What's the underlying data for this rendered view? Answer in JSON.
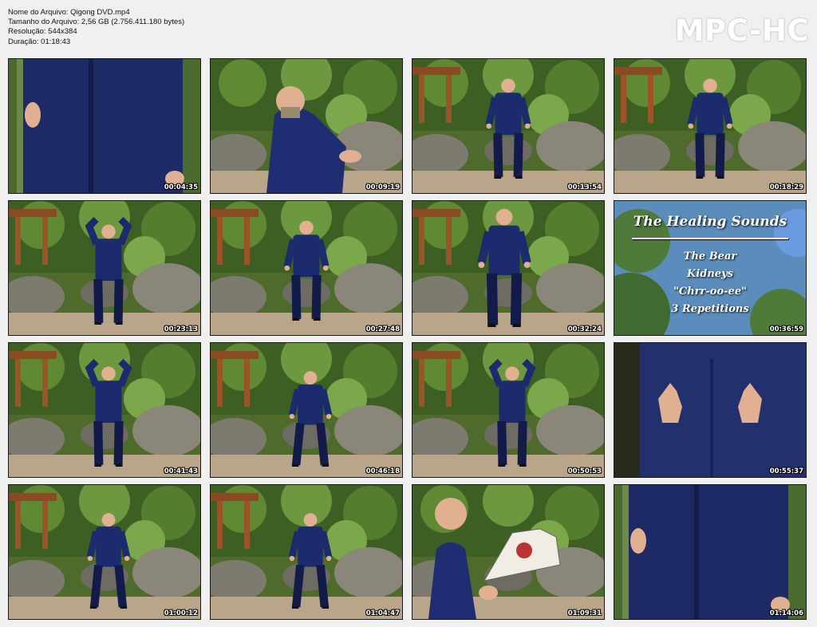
{
  "file_info": {
    "name": "Nome do Arquivo: Qigong DVD.mp4",
    "size": "Tamanho do Arquivo: 2,56 GB (2.756.411.180 bytes)",
    "resolution": "Resolução: 544x384",
    "duration": "Duração: 01:18:43"
  },
  "brand": "MPC-HC",
  "title_card": {
    "title": "The Healing Sounds",
    "lines": [
      "The Bear",
      "Kidneys",
      "\"Chrr-oo-ee\"",
      "3 Repetitions"
    ]
  },
  "thumbnails": [
    {
      "time": "00:04:35",
      "scene": "closeup-back"
    },
    {
      "time": "00:09:19",
      "scene": "closeup-side"
    },
    {
      "time": "00:13:54",
      "scene": "stand"
    },
    {
      "time": "00:18:29",
      "scene": "stand"
    },
    {
      "time": "00:23:13",
      "scene": "arms-up"
    },
    {
      "time": "00:27:48",
      "scene": "stand"
    },
    {
      "time": "00:32:24",
      "scene": "stand-close"
    },
    {
      "time": "00:36:59",
      "scene": "title"
    },
    {
      "time": "00:41:43",
      "scene": "arms-up"
    },
    {
      "time": "00:46:18",
      "scene": "wide-stance"
    },
    {
      "time": "00:50:53",
      "scene": "arms-up"
    },
    {
      "time": "00:55:37",
      "scene": "hands-back"
    },
    {
      "time": "01:00:12",
      "scene": "wide-stance"
    },
    {
      "time": "01:04:47",
      "scene": "wide-stance"
    },
    {
      "time": "01:09:31",
      "scene": "fan"
    },
    {
      "time": "01:14:06",
      "scene": "closeup-back"
    }
  ]
}
